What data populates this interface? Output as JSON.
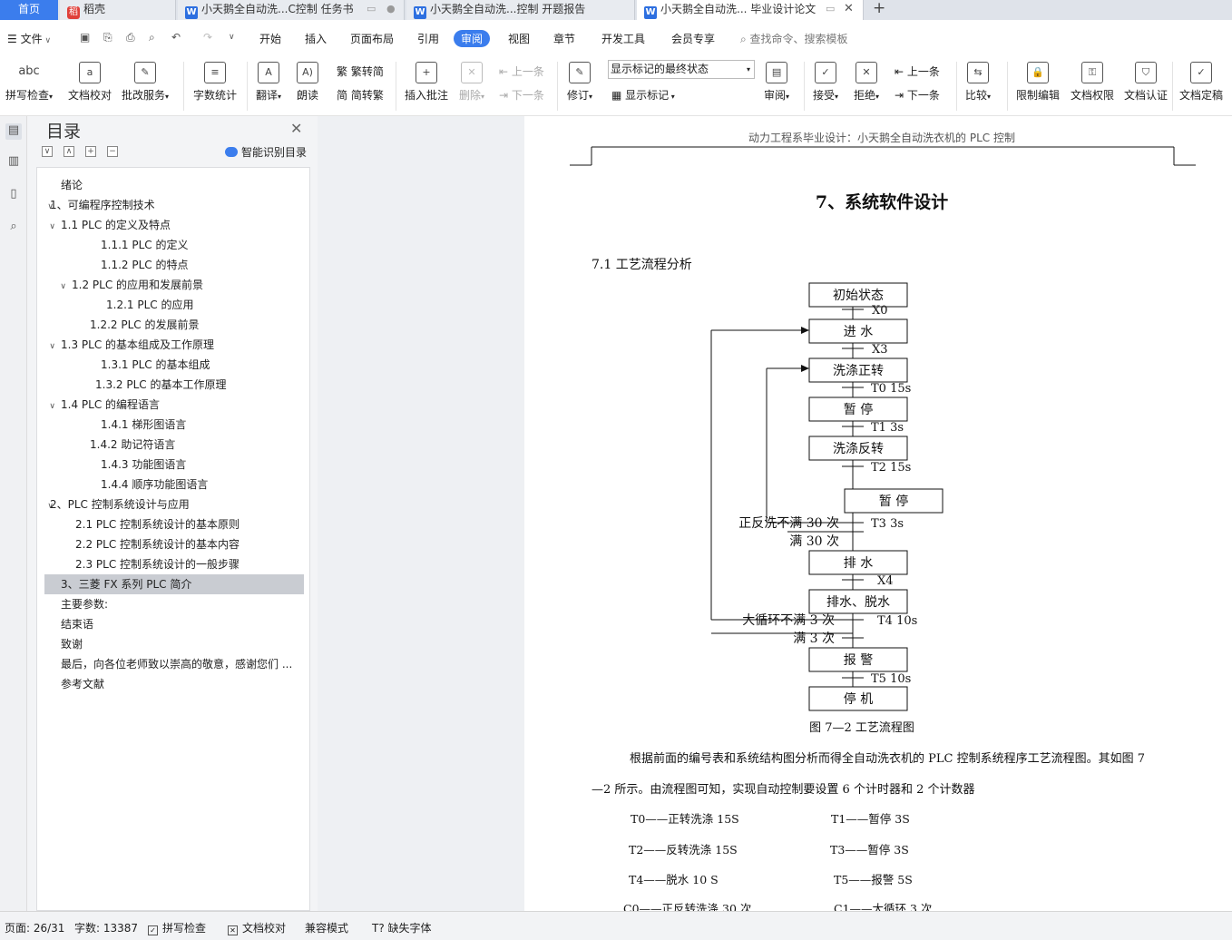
{
  "tabs": {
    "home": "首页",
    "docer": "稻壳",
    "doc1": "小天鹅全自动洗...C控制 任务书",
    "doc2": "小天鹅全自动洗...控制 开题报告",
    "doc3": "小天鹅全自动洗... 毕业设计论文",
    "new_tab": "+"
  },
  "menu": {
    "file": "文件",
    "items": [
      "开始",
      "插入",
      "页面布局",
      "引用",
      "审阅",
      "视图",
      "章节",
      "开发工具",
      "会员专享"
    ],
    "search": "查找命令、搜索模板"
  },
  "ribbon": {
    "spell": "拼写检查",
    "doc_check": "文档校对",
    "batch": "批改服务",
    "word_count": "字数统计",
    "translate": "翻译",
    "read": "朗读",
    "to_trad": "繁转简",
    "to_simp": "简转繁",
    "insert_comment": "插入批注",
    "delete": "删除",
    "prev_comment": "上一条",
    "next_comment": "下一条",
    "track": "修订",
    "markup_select": "显示标记的最终状态",
    "show_markup": "显示标记",
    "review": "审阅",
    "accept": "接受",
    "reject": "拒绝",
    "prev_change": "上一条",
    "next_change": "下一条",
    "compare": "比较",
    "restrict": "限制编辑",
    "permission": "文档权限",
    "certify": "文档认证",
    "finalize": "文档定稿"
  },
  "nav": {
    "title": "目录",
    "smart": "智能识别目录",
    "items": [
      {
        "label": "绪论",
        "caret": ""
      },
      {
        "label": "1、可编程序控制技术",
        "caret": "v"
      },
      {
        "label": "1.1      PLC 的定义及特点",
        "caret": "v"
      },
      {
        "label": "1.1.1      PLC 的定义",
        "caret": ""
      },
      {
        "label": "1.1.2    PLC 的特点",
        "caret": ""
      },
      {
        "label": "1.2        PLC 的应用和发展前景",
        "caret": "v"
      },
      {
        "label": "1.2.1    PLC 的应用",
        "caret": ""
      },
      {
        "label": "1.2.2    PLC 的发展前景",
        "caret": ""
      },
      {
        "label": "1.3    PLC 的基本组成及工作原理",
        "caret": "v"
      },
      {
        "label": "1.3.1 PLC 的基本组成",
        "caret": ""
      },
      {
        "label": "1.3.2    PLC 的基本工作原理",
        "caret": ""
      },
      {
        "label": "1.4    PLC 的编程语言",
        "caret": "v"
      },
      {
        "label": "1.4.1  梯形图语言",
        "caret": ""
      },
      {
        "label": "1.4.2  助记符语言",
        "caret": ""
      },
      {
        "label": "1.4.3  功能图语言",
        "caret": ""
      },
      {
        "label": "1.4.4 顺序功能图语言",
        "caret": ""
      },
      {
        "label": "2、PLC 控制系统设计与应用",
        "caret": "v"
      },
      {
        "label": "2.1    PLC 控制系统设计的基本原则",
        "caret": ""
      },
      {
        "label": "2.2    PLC 控制系统设计的基本内容",
        "caret": ""
      },
      {
        "label": "2.3    PLC 控制系统设计的一般步骤",
        "caret": ""
      },
      {
        "label": "3、三菱 FX 系列 PLC 简介",
        "caret": ""
      },
      {
        "label": "主要参数:",
        "caret": ""
      },
      {
        "label": "结束语",
        "caret": ""
      },
      {
        "label": "致谢",
        "caret": ""
      },
      {
        "label": "最后，向各位老师致以崇高的敬意，感谢您们 ...",
        "caret": ""
      },
      {
        "label": "参考文献",
        "caret": ""
      }
    ]
  },
  "doc": {
    "header": "动力工程系毕业设计：小天鹅全自动洗衣机的 PLC 控制",
    "chapter": "7、系统软件设计",
    "section": "7.1    工艺流程分析",
    "flow": {
      "steps": [
        "初始状态",
        "进    水",
        "洗涤正转",
        "暂    停",
        "洗涤反转",
        "暂    停",
        "排    水",
        "排水、脱水",
        "报    警",
        "停    机"
      ],
      "transitions": [
        "X0",
        "X3",
        "T0     15s",
        "T1      3s",
        "T2      15s",
        "T3     3s",
        "X4",
        "T4    10s",
        "T5     10s"
      ],
      "labels": {
        "small_not_full": "正反洗不满 30 次",
        "small_full": "满 30 次",
        "big_not_full": "大循环不满 3 次",
        "big_full": "满 3 次"
      }
    },
    "caption": "图 7—2 工艺流程图",
    "para1": "根据前面的编号表和系统结构图分析而得全自动洗衣机的 PLC 控制系统程序工艺流程图。其如图 7",
    "para2": "—2 所示。由流程图可知，实现自动控制要设置 6 个计时器和 2 个计数器",
    "timers": [
      [
        "T0——正转洗涤 15S",
        "T1——暂停 3S"
      ],
      [
        "T2——反转洗涤 15S",
        "T3——暂停 3S"
      ],
      [
        "T4——脱水 10 S",
        "T5——报警 5S"
      ],
      [
        "C0——正反转洗涤 30 次",
        "C1——大循环 3 次"
      ]
    ]
  },
  "status": {
    "page": "页面: 26/31",
    "words": "字数: 13387",
    "spell": "拼写检查",
    "check": "文档校对",
    "compat": "兼容模式",
    "fonts": "缺失字体"
  }
}
